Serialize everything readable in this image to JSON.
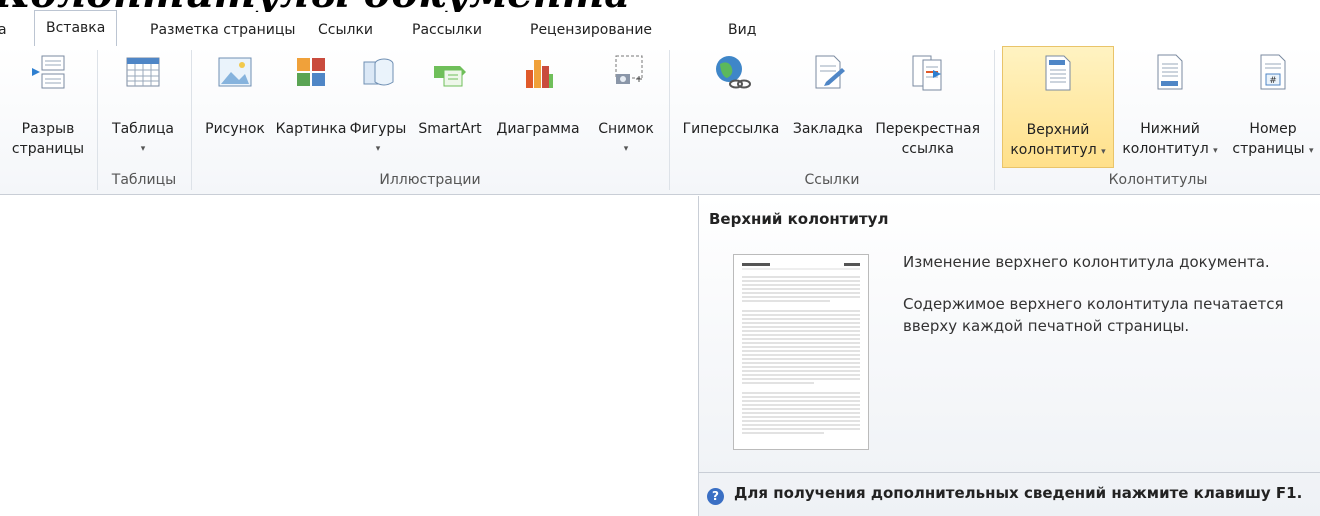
{
  "doc_title_partial": "Колонтитулы документа",
  "tabs": [
    {
      "label": "а"
    },
    {
      "label": "Вставка"
    },
    {
      "label": "Разметка страницы"
    },
    {
      "label": "Ссылки"
    },
    {
      "label": "Рассылки"
    },
    {
      "label": "Рецензирование"
    },
    {
      "label": "Вид"
    }
  ],
  "ribbon": {
    "page_break": {
      "line1": "Разрыв",
      "line2": "страницы",
      "icon": "page-break-icon"
    },
    "table": {
      "line1": "Таблица",
      "icon": "table-icon"
    },
    "picture": {
      "line1": "Рисунок",
      "icon": "picture-icon"
    },
    "clipart": {
      "line1": "Картинка",
      "icon": "clipart-icon"
    },
    "shapes": {
      "line1": "Фигуры",
      "icon": "shapes-icon"
    },
    "smartart": {
      "line1": "SmartArt",
      "icon": "smartart-icon"
    },
    "chart": {
      "line1": "Диаграмма",
      "icon": "chart-icon"
    },
    "screenshot": {
      "line1": "Снимок",
      "icon": "screenshot-icon"
    },
    "hyperlink": {
      "line1": "Гиперссылка",
      "icon": "hyperlink-icon"
    },
    "bookmark": {
      "line1": "Закладка",
      "icon": "bookmark-icon"
    },
    "crossref": {
      "line1": "Перекрестная",
      "line2": "ссылка",
      "icon": "cross-reference-icon"
    },
    "header": {
      "line1": "Верхний",
      "line2": "колонтитул",
      "icon": "header-icon"
    },
    "footer": {
      "line1": "Нижний",
      "line2": "колонтитул",
      "icon": "footer-icon"
    },
    "page_number": {
      "line1": "Номер",
      "line2": "страницы",
      "icon": "page-number-icon"
    },
    "dropdown_glyph": "▾",
    "groups": {
      "tables": "Таблицы",
      "illustrations": "Иллюстрации",
      "links": "Ссылки",
      "headers_footers": "Колонтитулы"
    }
  },
  "tooltip": {
    "title": "Верхний колонтитул",
    "description": "Изменение верхнего колонтитула документа.",
    "detail_line1": "Содержимое верхнего колонтитула печатается",
    "detail_line2": "вверху каждой печатной страницы.",
    "help": "Для получения дополнительных сведений нажмите клавишу F1.",
    "help_glyph": "?"
  },
  "colors": {
    "highlight": "#ffe08a",
    "accent_blue": "#3a6fc4"
  }
}
